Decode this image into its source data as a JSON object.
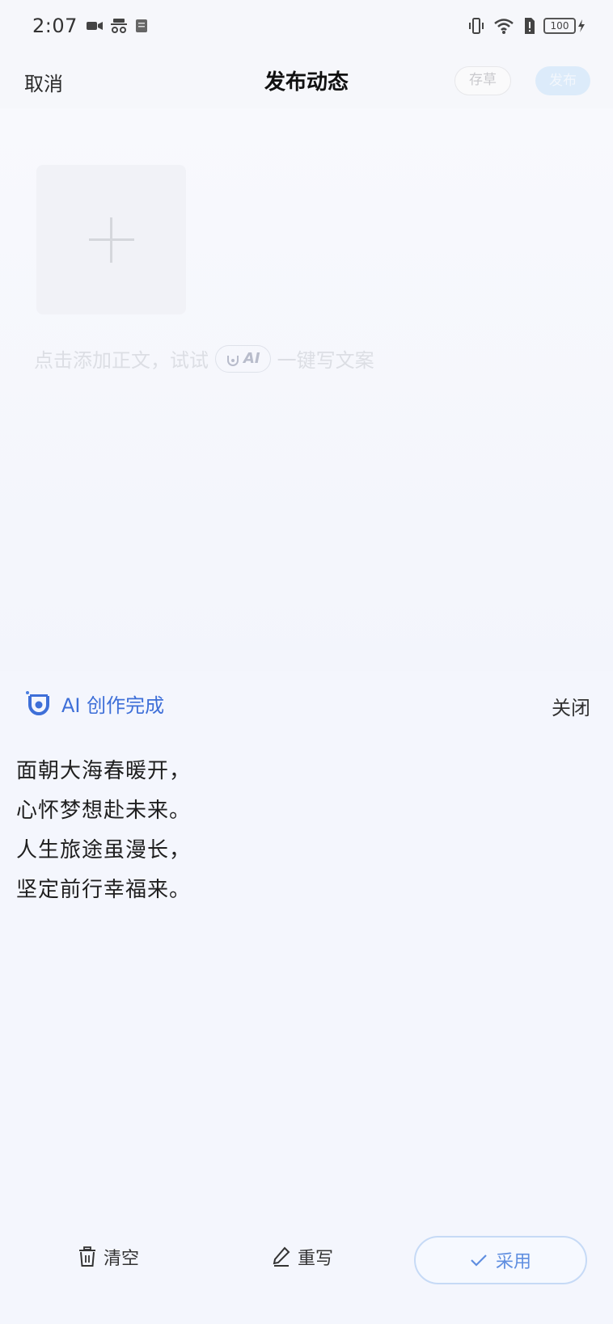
{
  "status_bar": {
    "time": "2:07",
    "battery_level": "100"
  },
  "header": {
    "cancel_label": "取消",
    "title": "发布动态",
    "draft_label": "存草",
    "publish_label": "发布"
  },
  "composer": {
    "hint_prefix": "点击添加正文，试试",
    "ai_pill_label": "AI",
    "hint_suffix": "一键写文案"
  },
  "ai_panel": {
    "title": "AI 创作完成",
    "close_label": "关闭",
    "poem_lines": [
      "面朝大海春暖开，",
      "心怀梦想赴未来。",
      "人生旅途虽漫长，",
      "坚定前行幸福来。"
    ]
  },
  "actions": {
    "clear_label": "清空",
    "rewrite_label": "重写",
    "adopt_label": "采用"
  },
  "colors": {
    "accent": "#3e6fd8",
    "background": "#f4f6fd"
  }
}
